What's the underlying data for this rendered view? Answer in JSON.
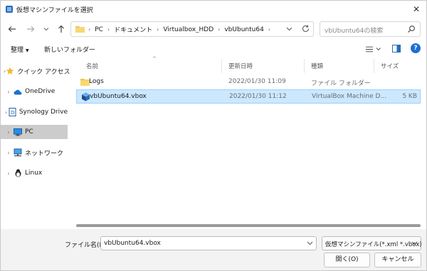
{
  "window": {
    "title": "仮想マシンファイルを選択",
    "close_glyph": "✕"
  },
  "address": {
    "crumbs": [
      "PC",
      "ドキュメント",
      "Virtualbox_HDD",
      "vbUbuntu64"
    ],
    "sep": "›"
  },
  "search": {
    "placeholder": "vbUbuntu64の検索"
  },
  "toolbar": {
    "organize_label": "整理",
    "organize_caret": "▼",
    "new_folder_label": "新しいフォルダー"
  },
  "sidebar": {
    "items": [
      {
        "label": "クイック アクセス",
        "icon": "star-icon"
      },
      {
        "label": "OneDrive",
        "icon": "cloud-icon"
      },
      {
        "label": "Synology Drive",
        "icon": "synology-icon"
      },
      {
        "label": "PC",
        "icon": "monitor-icon",
        "selected": true
      },
      {
        "label": "ネットワーク",
        "icon": "network-icon"
      },
      {
        "label": "Linux",
        "icon": "linux-icon"
      }
    ],
    "chevron": "›"
  },
  "filelist": {
    "columns": [
      "名前",
      "更新日時",
      "種類",
      "サイズ"
    ],
    "sort_caret": "^",
    "rows": [
      {
        "name": "Logs",
        "modified": "2022/01/30 11:09",
        "type": "ファイル フォルダー",
        "size": "",
        "icon": "folder-icon"
      },
      {
        "name": "vbUbuntu64.vbox",
        "modified": "2022/01/30 11:12",
        "type": "VirtualBox Machine D...",
        "size": "5 KB",
        "icon": "virtualbox-icon",
        "selected": true
      }
    ]
  },
  "bottom": {
    "filename_label": "ファイル名(N):",
    "filename_value": "vbUbuntu64.vbox",
    "filetype_value": "仮想マシンファイル(*.xml *.vbox)",
    "open_label": "開く(O)",
    "cancel_label": "キャンセル"
  },
  "colors": {
    "selection": "#cce8ff",
    "sidebar_selection": "#cccccc",
    "help_accent": "#1f6fd1"
  }
}
